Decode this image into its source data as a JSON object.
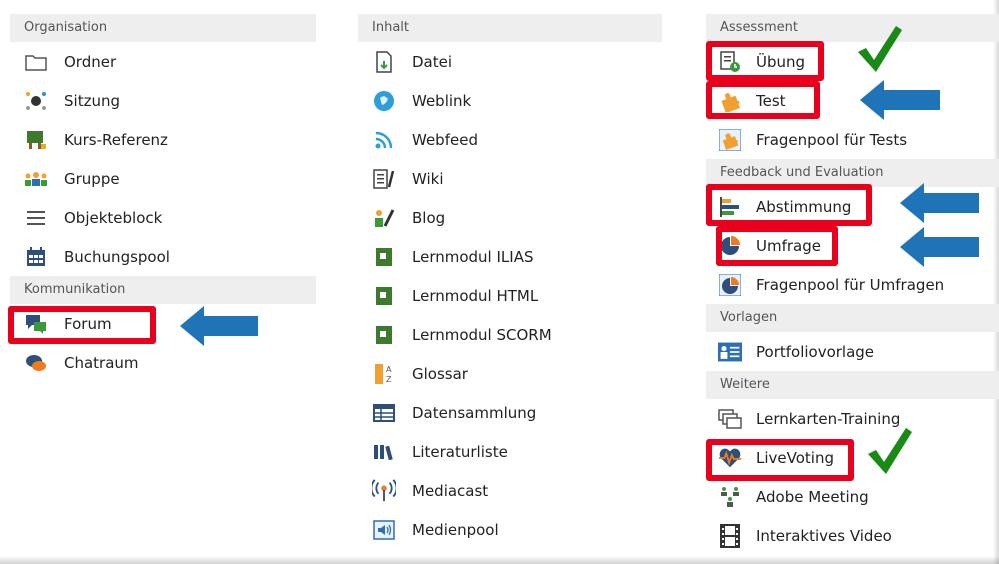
{
  "columns": [
    {
      "header": "Organisation",
      "items": [
        {
          "label": "Ordner",
          "icon": "folder-icon"
        },
        {
          "label": "Sitzung",
          "icon": "session-icon"
        },
        {
          "label": "Kurs-Referenz",
          "icon": "course-reference-icon"
        },
        {
          "label": "Gruppe",
          "icon": "group-icon"
        },
        {
          "label": "Objekteblock",
          "icon": "list-icon"
        },
        {
          "label": "Buchungspool",
          "icon": "calendar-icon"
        }
      ],
      "section2_header": "Kommunikation",
      "section2_items": [
        {
          "label": "Forum",
          "icon": "forum-icon"
        },
        {
          "label": "Chatraum",
          "icon": "chat-icon"
        }
      ]
    },
    {
      "header": "Inhalt",
      "items": [
        {
          "label": "Datei",
          "icon": "file-icon"
        },
        {
          "label": "Weblink",
          "icon": "weblink-icon"
        },
        {
          "label": "Webfeed",
          "icon": "rss-icon"
        },
        {
          "label": "Wiki",
          "icon": "wiki-icon"
        },
        {
          "label": "Blog",
          "icon": "blog-icon"
        },
        {
          "label": "Lernmodul ILIAS",
          "icon": "learning-module-icon"
        },
        {
          "label": "Lernmodul HTML",
          "icon": "learning-module-icon"
        },
        {
          "label": "Lernmodul SCORM",
          "icon": "learning-module-icon"
        },
        {
          "label": "Glossar",
          "icon": "glossary-icon"
        },
        {
          "label": "Datensammlung",
          "icon": "table-icon"
        },
        {
          "label": "Literaturliste",
          "icon": "books-icon"
        },
        {
          "label": "Mediacast",
          "icon": "broadcast-icon"
        },
        {
          "label": "Medienpool",
          "icon": "speaker-icon"
        }
      ]
    },
    {
      "header": "Assessment",
      "items": [
        {
          "label": "Übung",
          "icon": "exercise-icon"
        },
        {
          "label": "Test",
          "icon": "puzzle-icon"
        },
        {
          "label": "Fragenpool für Tests",
          "icon": "puzzle-icon"
        }
      ],
      "section2_header": "Feedback und Evaluation",
      "section2_items": [
        {
          "label": "Abstimmung",
          "icon": "poll-icon"
        },
        {
          "label": "Umfrage",
          "icon": "survey-icon"
        },
        {
          "label": "Fragenpool für Umfragen",
          "icon": "survey-icon"
        }
      ],
      "section3_header": "Vorlagen",
      "section3_items": [
        {
          "label": "Portfoliovorlage",
          "icon": "portfolio-icon"
        }
      ],
      "section4_header": "Weitere",
      "section4_items": [
        {
          "label": "Lernkarten-Training",
          "icon": "cards-icon"
        },
        {
          "label": "LiveVoting",
          "icon": "livevoting-icon"
        },
        {
          "label": "Adobe Meeting",
          "icon": "meeting-icon"
        },
        {
          "label": "Interaktives Video",
          "icon": "film-icon"
        }
      ]
    }
  ],
  "colors": {
    "highlight": "#e8001c",
    "arrow": "#1f73b7",
    "check": "#1a8a16",
    "header_bg": "#eeeeee"
  }
}
